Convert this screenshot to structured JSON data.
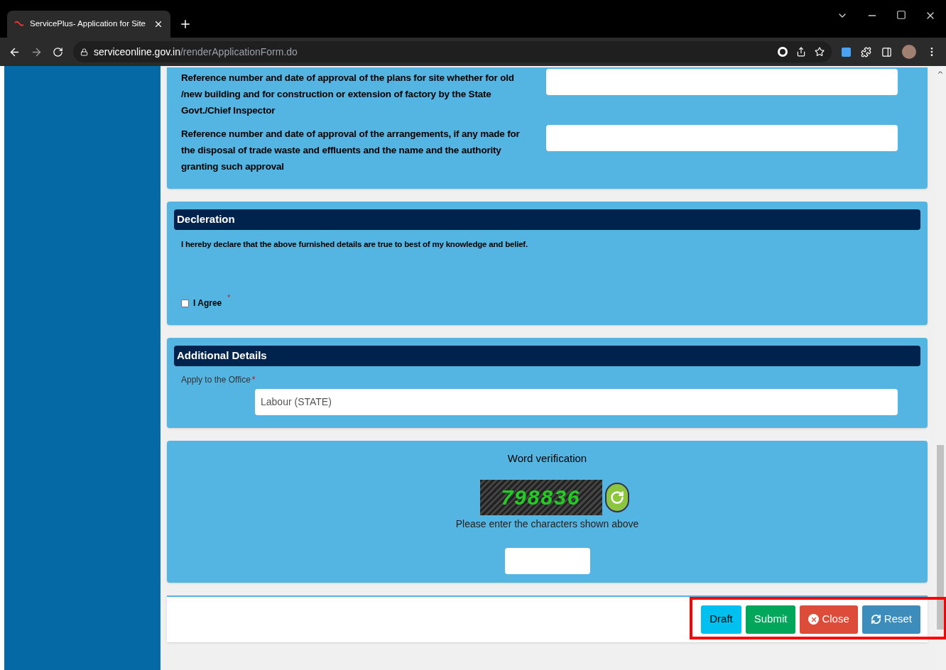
{
  "browser": {
    "tab_title": "ServicePlus- Application for Site",
    "url_host": "serviceonline.gov.in",
    "url_path": "/renderApplicationForm.do"
  },
  "approvals": [
    {
      "label": "Reference number and date of approval of the plans for site whether for old /new building and for construction or extension of factory by the State Govt./Chief Inspector"
    },
    {
      "label": "Reference number and date of approval of the arrangements, if any made for the disposal of trade waste and effluents and the name and the authority granting such approval"
    }
  ],
  "declaration": {
    "title": "Decleration",
    "text": "I hereby declare that the above furnished details are true to best of my knowledge and belief.",
    "agree_label": "I Agree",
    "required_mark": "*",
    "checked": false
  },
  "additional": {
    "title": "Additional Details",
    "office_label": "Apply to the Office",
    "required_mark": "*",
    "office_value": "Labour (STATE)"
  },
  "verification": {
    "title": "Word verification",
    "captcha": "798836",
    "hint": "Please enter the characters shown above"
  },
  "buttons": [
    {
      "kind": "draft",
      "label": "Draft"
    },
    {
      "kind": "submit",
      "label": "Submit"
    },
    {
      "kind": "close",
      "label": "Close"
    },
    {
      "kind": "reset",
      "label": "Reset"
    }
  ],
  "highlight": {
    "on": true
  }
}
